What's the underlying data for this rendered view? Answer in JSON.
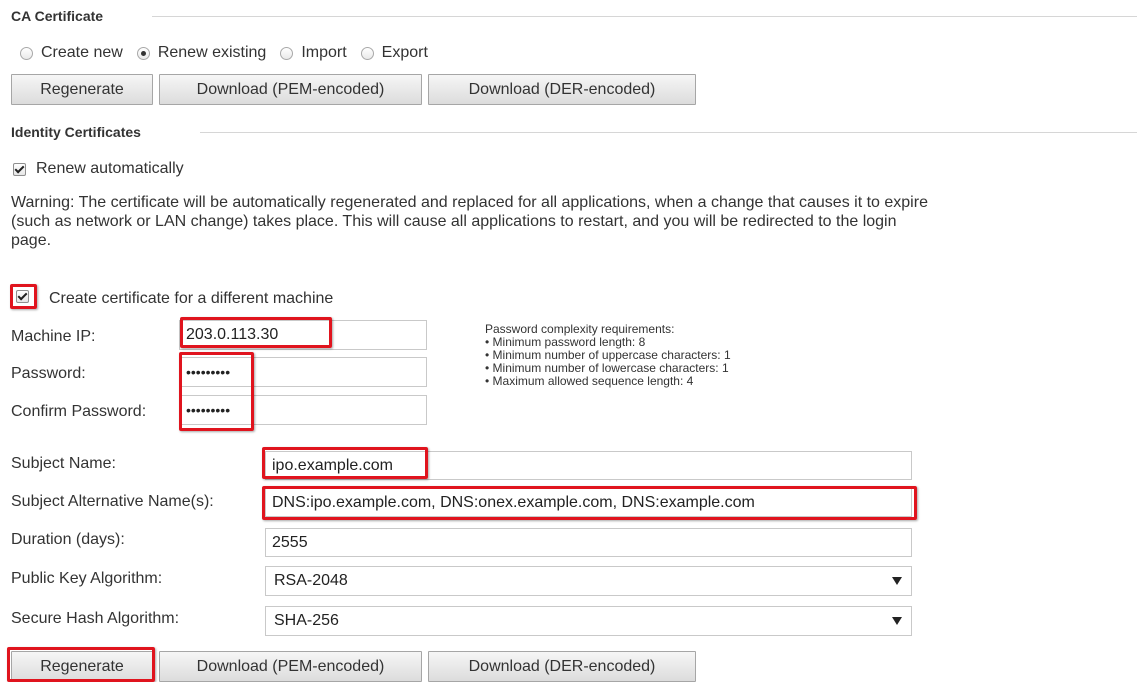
{
  "ca_section": {
    "title": "CA Certificate",
    "radios": [
      {
        "label": "Create new",
        "checked": false
      },
      {
        "label": "Renew existing",
        "checked": true
      },
      {
        "label": "Import",
        "checked": false
      },
      {
        "label": "Export",
        "checked": false
      }
    ],
    "buttons": {
      "regenerate": "Regenerate",
      "download_pem": "Download (PEM-encoded)",
      "download_der": "Download (DER-encoded)"
    }
  },
  "identity_section": {
    "title": "Identity Certificates",
    "renew_automatically": {
      "label": "Renew automatically",
      "checked": true
    },
    "warning_lines": [
      "Warning: The certificate will be automatically regenerated and replaced for all applications, when a change that causes it to expire",
      "(such as network or LAN change) takes place. This will cause all applications to restart, and you will be redirected to the login",
      "page."
    ],
    "different_machine": {
      "label": "Create certificate for a different machine",
      "checked": true
    },
    "machine_ip": {
      "label": "Machine IP:",
      "value": "203.0.113.30"
    },
    "password": {
      "label": "Password:",
      "value": "•••••••••"
    },
    "confirm_password": {
      "label": "Confirm Password:",
      "value": "•••••••••"
    },
    "password_requirements": {
      "heading": "Password complexity requirements:",
      "items": [
        "• Minimum password length: 8",
        "• Minimum number of uppercase characters: 1",
        "• Minimum number of lowercase characters: 1",
        "• Maximum allowed sequence length: 4"
      ]
    },
    "subject_name": {
      "label": "Subject Name:",
      "value": "ipo.example.com"
    },
    "subject_alt_names": {
      "label": "Subject Alternative Name(s):",
      "value": "DNS:ipo.example.com, DNS:onex.example.com, DNS:example.com"
    },
    "duration": {
      "label": "Duration (days):",
      "value": "2555"
    },
    "public_key_algorithm": {
      "label": "Public Key Algorithm:",
      "value": "RSA-2048"
    },
    "secure_hash_algorithm": {
      "label": "Secure Hash Algorithm:",
      "value": "SHA-256"
    },
    "buttons": {
      "regenerate": "Regenerate",
      "download_pem": "Download (PEM-encoded)",
      "download_der": "Download (DER-encoded)"
    }
  },
  "colors": {
    "highlight": "#e0141e",
    "text": "#333333",
    "border": "#c9c9c9"
  }
}
